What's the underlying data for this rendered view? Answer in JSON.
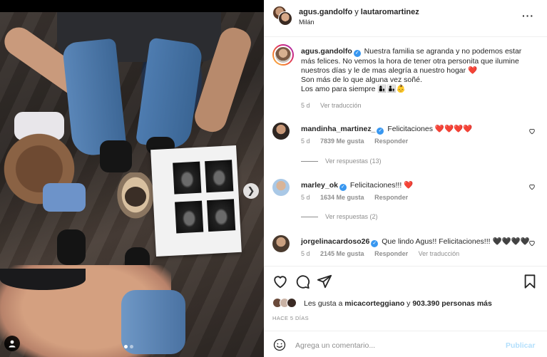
{
  "post": {
    "header": {
      "user1": "agus.gandolfo",
      "connector": "y",
      "user2": "lautaromartinez",
      "location": "Milán",
      "more_icon": "more-horizontal-icon"
    },
    "caption": {
      "username": "agus.gandolfo",
      "text_line1": "Nuestra familia se agranda y no podemos estar más felices. No vemos la hora de tener otra personita que ilumine nuestros días y le de mas alegría a nuestro hogar",
      "heart": "❤️",
      "text_line2": "Son más de lo que alguna vez soñé.",
      "text_line3": "Los amo para siempre",
      "family_emoji": "👩‍👦👨‍👦👶",
      "age": "5 d",
      "translate": "Ver traducción"
    },
    "comments": [
      {
        "username": "mandinha_martinez_",
        "text": "Felicitaciones ❤️❤️❤️❤️",
        "age": "5 d",
        "likes": "7839 Me gusta",
        "reply": "Responder",
        "replies": "Ver respuestas (13)"
      },
      {
        "username": "marley_ok",
        "text": "Felicitaciones!!! ❤️",
        "age": "5 d",
        "likes": "1634 Me gusta",
        "reply": "Responder",
        "replies": "Ver respuestas (2)"
      },
      {
        "username": "jorgelinacardoso26",
        "text": "Que lindo Agus!! Felicitaciones!!! 🖤🖤🖤🖤",
        "age": "5 d",
        "likes": "2145 Me gusta",
        "reply": "Responder",
        "translate": "Ver traducción"
      }
    ],
    "likes": {
      "prefix": "Les gusta a",
      "user": "micacorteggiano",
      "middle": "y",
      "count": "903.390 personas más"
    },
    "posted_ago": "HACE 5 DÍAS",
    "add_comment": {
      "placeholder": "Agrega un comentario...",
      "publish": "Publicar"
    },
    "carousel": {
      "total": 2,
      "active": 1
    }
  },
  "colors": {
    "link_blue": "#3897f0",
    "heart_red": "#e0245e",
    "muted": "#8e8e8e",
    "publish_disabled": "#b2dffc"
  }
}
